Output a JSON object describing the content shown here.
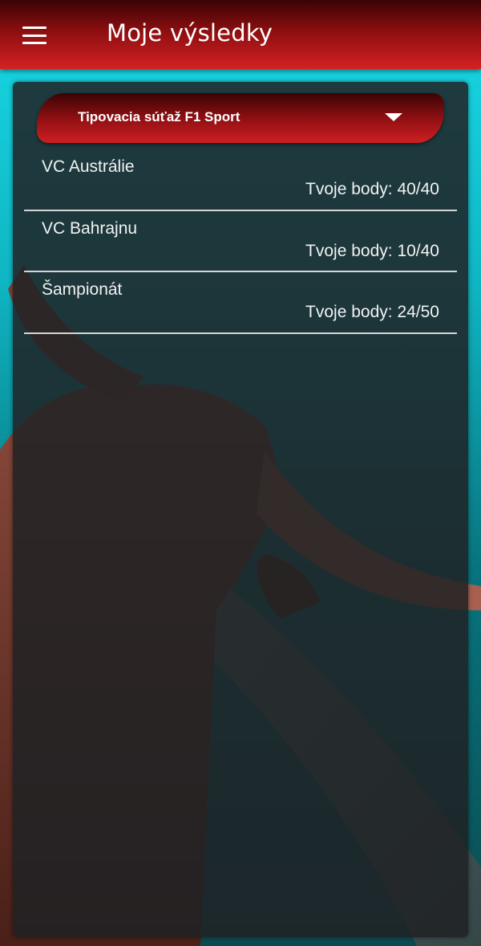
{
  "header": {
    "title": "Moje výsledky",
    "menu_icon": "hamburger-menu-icon"
  },
  "competition_select": {
    "selected": "Tipovacia súťaž F1 Sport",
    "arrow_icon": "dropdown-arrow-icon"
  },
  "results": [
    {
      "name": "VC Austrálie",
      "points": "Tvoje body: 40/40"
    },
    {
      "name": "VC Bahrajnu",
      "points": "Tvoje body: 10/40"
    },
    {
      "name": "Šampionát",
      "points": "Tvoje body: 24/50"
    }
  ],
  "colors": {
    "header_dark": "#3a0304",
    "header_light": "#d42123",
    "panel": "#202224",
    "background_cyan": "#19d9e6",
    "divider": "#d5d5d5"
  }
}
